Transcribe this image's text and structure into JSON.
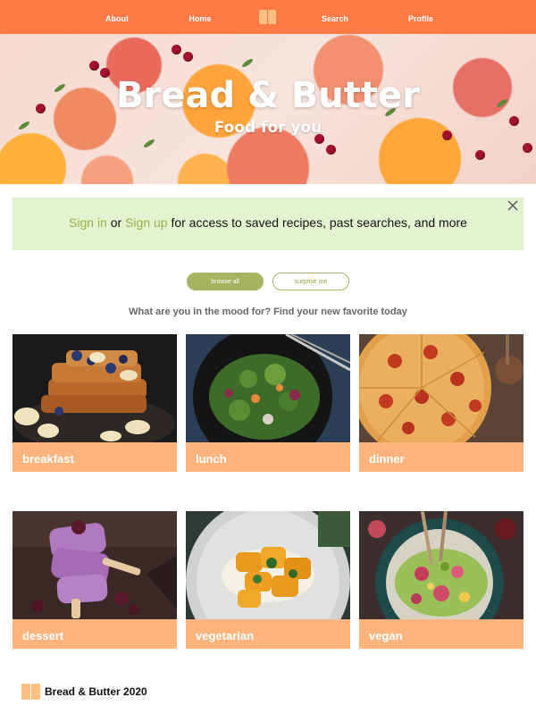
{
  "nav": {
    "about": "About",
    "home": "Home",
    "search": "Search",
    "profile": "Profile",
    "logo_icon": "open-book-icon"
  },
  "hero": {
    "title": "Bread & Butter",
    "subtitle": "Food for you"
  },
  "signin_banner": {
    "sign_in": "Sign in",
    "or": "or",
    "sign_up": "Sign up",
    "rest": "for access to saved recipes, past searches, and more",
    "close_icon": "close-icon"
  },
  "buttons": {
    "browse_all": "browse all",
    "surprise_me": "surprise me"
  },
  "tagline": "What are you in the mood for? Find your new favorite today",
  "categories": [
    {
      "label": "breakfast"
    },
    {
      "label": "lunch"
    },
    {
      "label": "dinner"
    },
    {
      "label": "dessert"
    },
    {
      "label": "vegetarian"
    },
    {
      "label": "vegan"
    }
  ],
  "footer": {
    "text": "Bread & Butter 2020"
  },
  "colors": {
    "nav": "#ff7a45",
    "accent_green": "#a5b45f",
    "banner_bg": "#e3f3cf",
    "card_label_bg": "#ffb47d"
  }
}
